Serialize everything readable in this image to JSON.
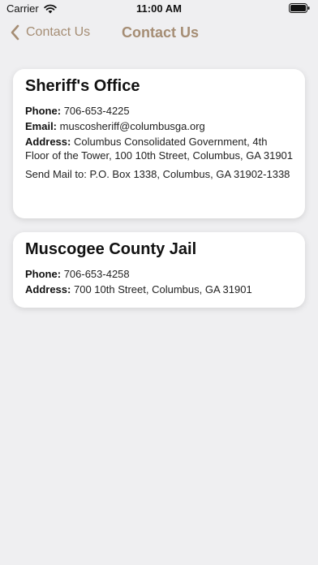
{
  "status_bar": {
    "carrier": "Carrier",
    "time": "11:00 AM"
  },
  "nav": {
    "back_label": "Contact Us",
    "title": "Contact Us"
  },
  "cards": [
    {
      "title": "Sheriff's Office",
      "phone_label": "Phone:",
      "phone": "706-653-4225",
      "email_label": "Email:",
      "email": "muscosheriff@columbusga.org",
      "address_label": "Address:",
      "address": "Columbus Consolidated Government, 4th Floor of the Tower, 100 10th Street, Columbus, GA 31901",
      "mail": "Send Mail to: P.O. Box 1338, Columbus, GA 31902-1338"
    },
    {
      "title": "Muscogee County Jail",
      "phone_label": "Phone:",
      "phone": "706-653-4258",
      "address_label": "Address:",
      "address": "700 10th Street, Columbus, GA 31901"
    }
  ],
  "colors": {
    "accent": "#a58d74",
    "background": "#efeff1",
    "card": "#ffffff"
  },
  "icons": {
    "wifi": "wifi-icon",
    "battery": "battery-icon",
    "back": "chevron-left-icon"
  }
}
